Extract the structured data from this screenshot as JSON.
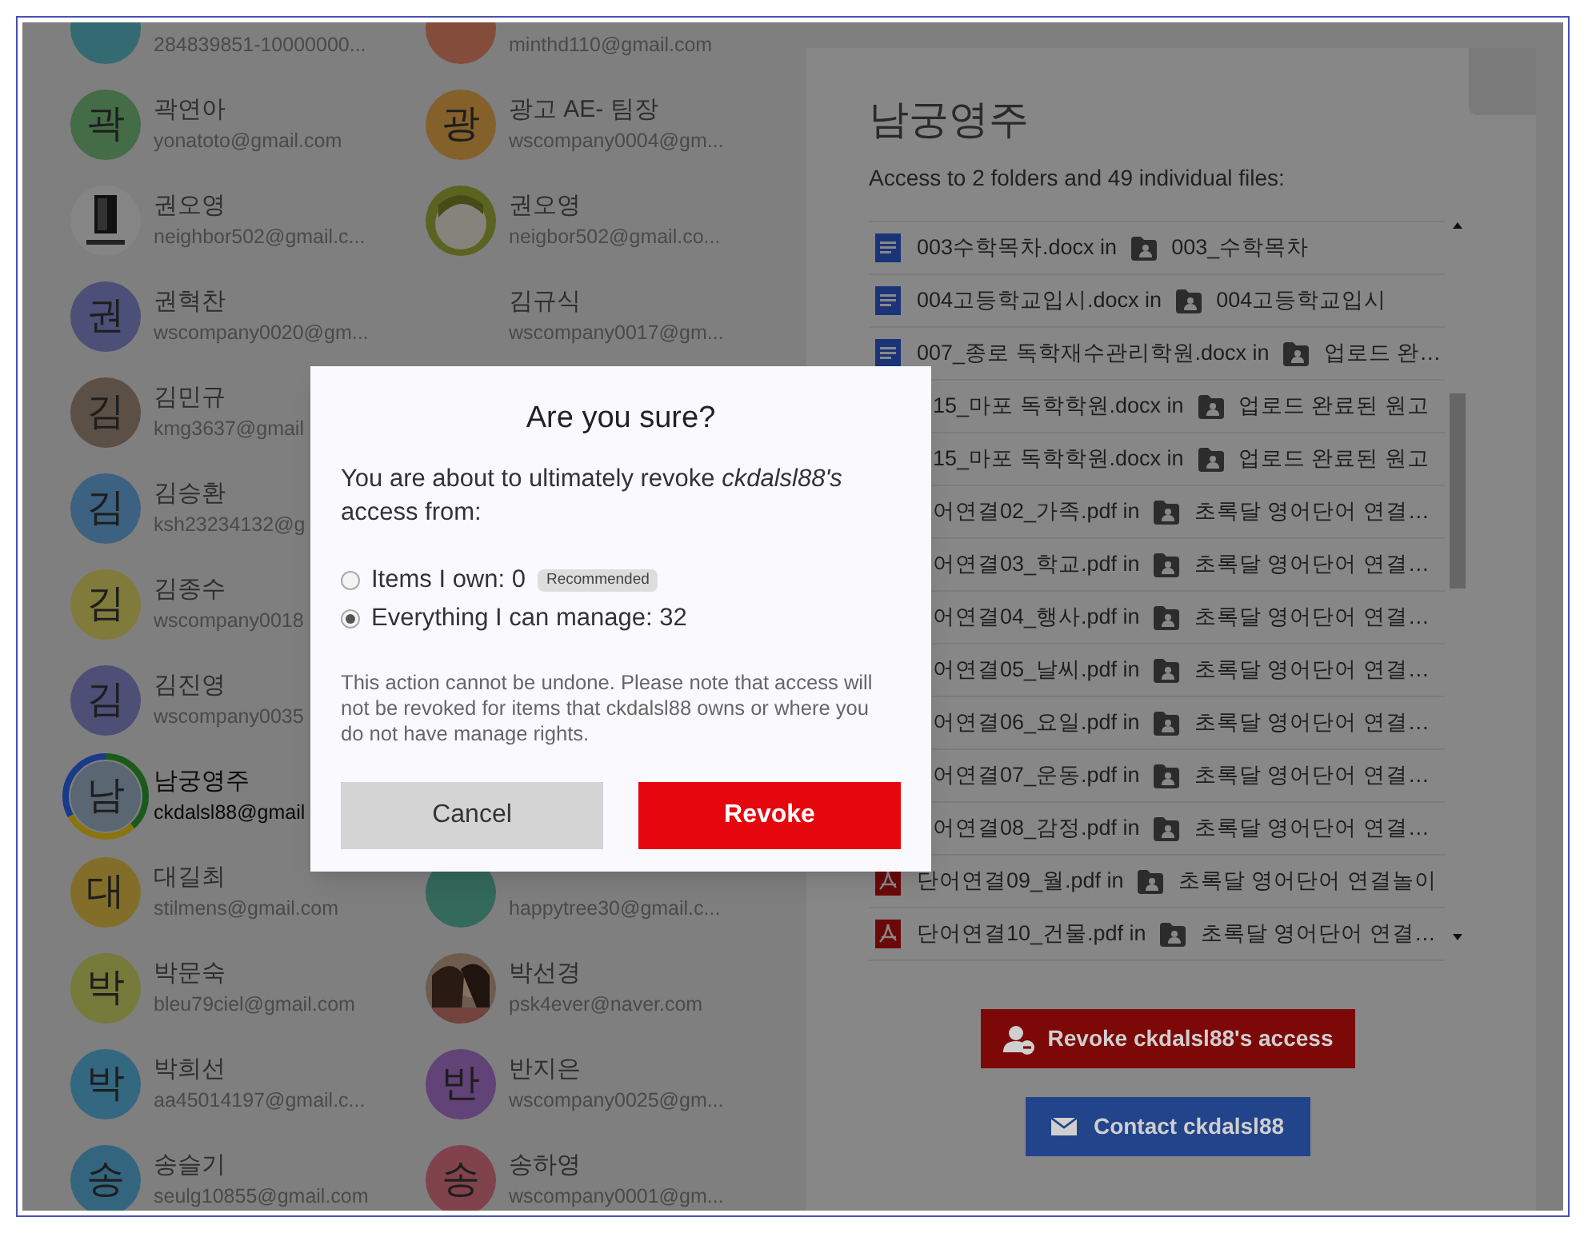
{
  "contacts": [
    {
      "cells": [
        {
          "kind": "initial",
          "color": "#346a72",
          "email": "284839851-10000000...",
          "selected": false
        },
        {
          "kind": "initial",
          "color": "#844c3a",
          "email": "minthd110@gmail.com",
          "selected": false
        }
      ]
    },
    {
      "cells": [
        {
          "kind": "initial",
          "initial": "곽",
          "color": "#446c46",
          "name": "곽연아",
          "email": "yonatoto@gmail.com",
          "selected": false
        },
        {
          "kind": "initial",
          "initial": "광",
          "color": "#84612a",
          "name": "광고 AE- 팀장",
          "email": "wscompany0004@gm...",
          "selected": false
        }
      ]
    },
    {
      "cells": [
        {
          "kind": "picture",
          "name": "권오영",
          "email": "neighbor502@gmail.c...",
          "selected": false
        },
        {
          "kind": "picture",
          "name": "권오영",
          "email": "neigbor502@gmail.co...",
          "selected": false
        }
      ]
    },
    {
      "cells": [
        {
          "kind": "initial",
          "initial": "권",
          "color": "#4c4f77",
          "name": "권혁찬",
          "email": "wscompany0020@gm...",
          "selected": false
        },
        {
          "kind": "none",
          "name": "김규식",
          "email": "wscompany0017@gm...",
          "selected": false
        }
      ]
    },
    {
      "cells": [
        {
          "kind": "initial",
          "initial": "김",
          "color": "#5c4f46",
          "name": "김민규",
          "email": "kmg3637@gmail",
          "selected": false
        }
      ]
    },
    {
      "cells": [
        {
          "kind": "initial",
          "initial": "김",
          "color": "#3d6180",
          "name": "김승환",
          "email": "ksh23234132@g",
          "selected": false
        }
      ]
    },
    {
      "cells": [
        {
          "kind": "initial",
          "initial": "김",
          "color": "#807b3a",
          "name": "김종수",
          "email": "wscompany0018",
          "selected": false
        }
      ]
    },
    {
      "cells": [
        {
          "kind": "initial",
          "initial": "김",
          "color": "#4d4f76",
          "name": "김진영",
          "email": "wscompany0035",
          "selected": false
        }
      ]
    },
    {
      "cells": [
        {
          "kind": "initial",
          "initial": "남",
          "color": "#5a6672",
          "name": "남궁영주",
          "email": "ckdalsl88@gmail",
          "selected": true
        }
      ]
    },
    {
      "cells": [
        {
          "kind": "initial",
          "initial": "대",
          "color": "#826e29",
          "name": "대길최",
          "email": "stilmens@gmail.com",
          "selected": false
        },
        {
          "kind": "initial",
          "color": "#346a5b",
          "email": "happytree30@gmail.c...",
          "selected": false
        }
      ]
    },
    {
      "cells": [
        {
          "kind": "initial",
          "initial": "박",
          "color": "#767a3a",
          "name": "박문숙",
          "email": "bleu79ciel@gmail.com",
          "selected": false
        },
        {
          "kind": "picture",
          "name": "박선경",
          "email": "psk4ever@naver.com",
          "selected": false
        }
      ]
    },
    {
      "cells": [
        {
          "kind": "initial",
          "initial": "박",
          "color": "#336880",
          "name": "박희선",
          "email": "aa45014197@gmail.c...",
          "selected": false
        },
        {
          "kind": "initial",
          "initial": "반",
          "color": "#614377",
          "name": "반지은",
          "email": "wscompany0025@gm...",
          "selected": false
        }
      ]
    },
    {
      "cells": [
        {
          "kind": "initial",
          "initial": "송",
          "color": "#34657f",
          "name": "송슬기",
          "email": "seulg10855@gmail.com",
          "selected": false
        },
        {
          "kind": "initial",
          "initial": "송",
          "color": "#80434c",
          "name": "송하영",
          "email": "wscompany0001@gm...",
          "selected": false
        }
      ]
    }
  ],
  "panel": {
    "title": "남궁영주",
    "subtitle": "Access to 2 folders and 49 individual files:",
    "files": [
      {
        "kind": "doc",
        "file": "003수학목차.docx in",
        "folder": "003_수학목차"
      },
      {
        "kind": "doc",
        "file": "004고등학교입시.docx in",
        "folder": "004고등학교입시"
      },
      {
        "kind": "doc",
        "file": "007_종로 독학재수관리학원.docx in",
        "folder": "업로드 완…"
      },
      {
        "kind": "covered",
        "file": "15_마포 독학학원.docx in",
        "folder": "업로드 완료된 원고"
      },
      {
        "kind": "covered",
        "file": "15_마포 독학학원.docx in",
        "folder": "업로드 완료된 원고"
      },
      {
        "kind": "covered",
        "file": "어연결02_가족.pdf in",
        "folder": "초록달 영어단어 연결…"
      },
      {
        "kind": "covered",
        "file": "어연결03_학교.pdf in",
        "folder": "초록달 영어단어 연결…"
      },
      {
        "kind": "covered",
        "file": "어연결04_행사.pdf in",
        "folder": "초록달 영어단어 연결…"
      },
      {
        "kind": "covered",
        "file": "어연결05_날씨.pdf in",
        "folder": "초록달 영어단어 연결…"
      },
      {
        "kind": "covered",
        "file": "어연결06_요일.pdf in",
        "folder": "초록달 영어단어 연결…"
      },
      {
        "kind": "covered",
        "file": "어연결07_운동.pdf in",
        "folder": "초록달 영어단어 연결…"
      },
      {
        "kind": "covered",
        "file": "어연결08_감정.pdf in",
        "folder": "초록달 영어단어 연결…"
      },
      {
        "kind": "pdf",
        "file": "단어연결09_월.pdf in",
        "folder": "초록달 영어단어 연결놀이"
      },
      {
        "kind": "pdf",
        "file": "단어연결10_건물.pdf in",
        "folder": "초록달 영어단어 연결…"
      }
    ],
    "revoke_button": "Revoke ckdalsl88's access",
    "contact_button": "Contact ckdalsl88"
  },
  "dialog": {
    "title": "Are you sure?",
    "message": "You are about to ultimately revoke *ckdalsl88's* access from:",
    "options": [
      {
        "label": "Items I own: 0",
        "badge": "Recommended",
        "selected": false
      },
      {
        "label": "Everything I can manage: 32",
        "selected": true
      }
    ],
    "note": "This action cannot be undone. Please note that access will not be revoked for items that ckdalsl88 owns or where you do not have manage rights.",
    "buttons": [
      {
        "label": "Cancel",
        "kind": "secondary"
      },
      {
        "label": "Revoke",
        "kind": "danger"
      }
    ]
  }
}
